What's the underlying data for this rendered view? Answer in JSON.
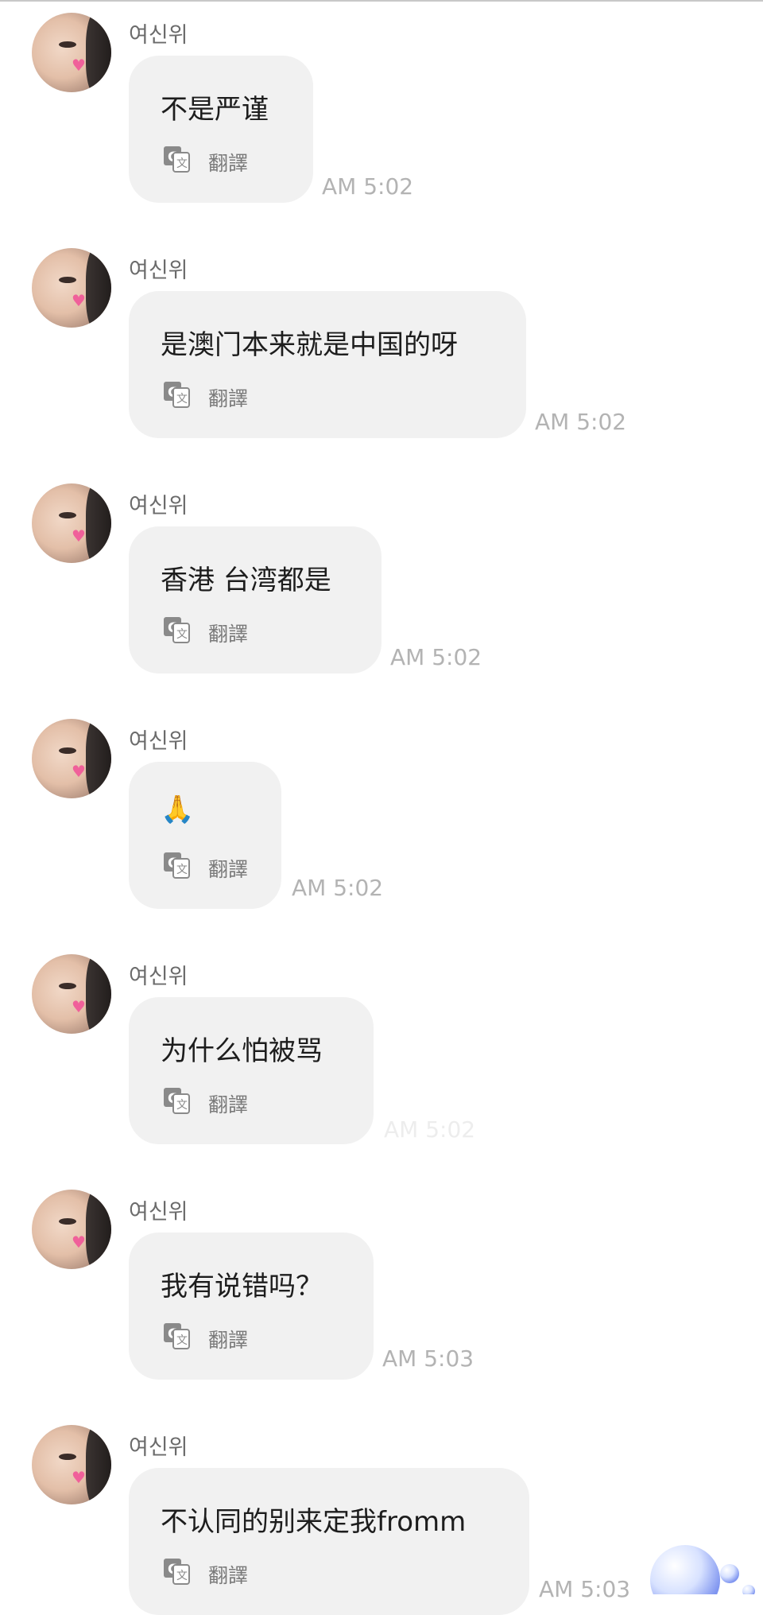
{
  "chat": {
    "messages": [
      {
        "sender": "여신위",
        "text": "不是严谨",
        "translate_label": "翻譯",
        "time": "AM 5:02"
      },
      {
        "sender": "여신위",
        "text": "是澳门本来就是中国的呀",
        "translate_label": "翻譯",
        "time": "AM 5:02"
      },
      {
        "sender": "여신위",
        "text": "香港 台湾都是",
        "translate_label": "翻譯",
        "time": "AM 5:02"
      },
      {
        "sender": "여신위",
        "text": "🙏",
        "translate_label": "翻譯",
        "time": "AM 5:02"
      },
      {
        "sender": "여신위",
        "text": "为什么怕被骂",
        "translate_label": "翻譯",
        "time": "AM 5:02"
      },
      {
        "sender": "여신위",
        "text": "我有说错吗？",
        "translate_label": "翻譯",
        "time": "AM 5:03"
      },
      {
        "sender": "여신위",
        "text": "不认同的别来定我fromm",
        "translate_label": "翻譯",
        "time": "AM 5:03"
      }
    ]
  },
  "icons": {
    "translate": "translate-icon",
    "avatar": "avatar",
    "decoration": "bubbles-decoration"
  },
  "colors": {
    "bubble_bg": "#f1f1f1",
    "name": "#6b6b6b",
    "time": "#b3b3b3",
    "text": "#1d1d1d"
  }
}
